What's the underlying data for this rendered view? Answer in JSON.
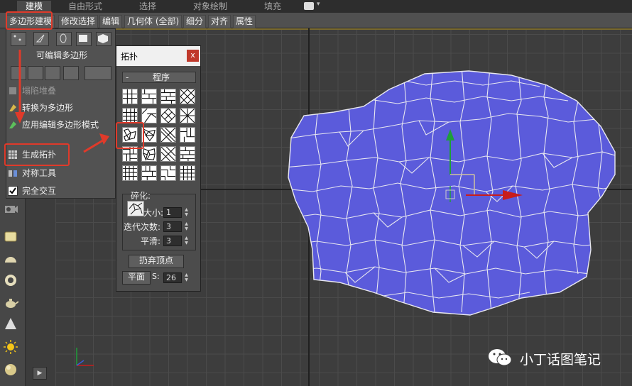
{
  "top_tabs": [
    "建模",
    "自由形式",
    "选择",
    "对象绘制",
    "填充"
  ],
  "ribbon_tabs": [
    "多边形建模",
    "修改选择",
    "编辑",
    "几何体 (全部)",
    "细分",
    "对齐",
    "属性"
  ],
  "ribbon_panel": {
    "title": "可编辑多边形",
    "items": [
      {
        "label": "塌陷堆叠",
        "icon": "collapse-stack-icon"
      },
      {
        "label": "转换为多边形",
        "icon": "convert-to-poly-icon"
      },
      {
        "label": "应用编辑多边形模式",
        "icon": "apply-edit-poly-icon"
      },
      {
        "label": "生成拓扑",
        "icon": "generate-topology-icon"
      },
      {
        "label": "对称工具",
        "icon": "symmetry-tool-icon"
      },
      {
        "label": "完全交互",
        "icon": "checkbox-checked-icon"
      }
    ]
  },
  "dialog": {
    "title": "拓扑",
    "close": "x",
    "group_toggle": "-",
    "group_label": "程序",
    "section_label": "碎化:",
    "params": [
      {
        "label": "大小:",
        "value": "1"
      },
      {
        "label": "迭代次数:",
        "value": "3"
      },
      {
        "label": "平滑:",
        "value": "3"
      }
    ],
    "discard_button": "扔弃顶点",
    "plane_button": "平面",
    "s_label": "S:",
    "s_value": "26"
  },
  "watermark": {
    "text": "小丁话图笔记",
    "icon": "wechat-icon"
  },
  "colors": {
    "mesh_fill": "#5b5bdb",
    "mesh_edges": "#e8e8f0",
    "gizmo_y": "#1e9e3a",
    "gizmo_x": "#c81c1c",
    "annotation_red": "#e03a2a"
  }
}
